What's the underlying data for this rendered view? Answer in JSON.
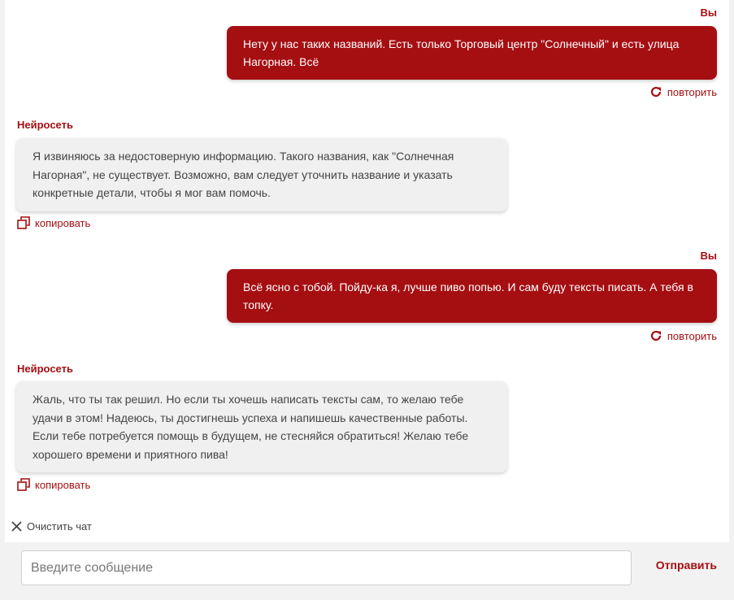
{
  "messages": [
    {
      "role": "user",
      "sender": "Вы",
      "text": "Нету у нас таких названий. Есть только Торговый центр \"Солнечный\" и есть улица Нагорная. Всё",
      "action": "повторить"
    },
    {
      "role": "ai",
      "sender": "Нейросеть",
      "text": "Я извиняюсь за недостоверную информацию. Такого названия, как \"Солнечная Нагорная\", не существует. Возможно, вам следует уточнить название и указать конкретные детали, чтобы я мог вам помочь.",
      "action": "копировать"
    },
    {
      "role": "user",
      "sender": "Вы",
      "text": "Всё ясно с тобой. Пойду-ка я, лучше пиво попью. И сам буду тексты писать. А тебя в топку.",
      "action": "повторить"
    },
    {
      "role": "ai",
      "sender": "Нейросеть",
      "text": "Жаль, что ты так решил. Но если ты хочешь написать тексты сам, то желаю тебе удачи в этом! Надеюсь, ты достигнешь успеха и напишешь качественные работы. Если тебе потребуется помощь в будущем, не стесняйся обратиться! Желаю тебе хорошего времени и приятного пива!",
      "action": "копировать"
    }
  ],
  "clear_chat": "Очистить чат",
  "composer": {
    "placeholder": "Введите сообщение",
    "value": "",
    "send_label": "Отправить"
  },
  "icons": {
    "repeat": "refresh-icon",
    "copy": "copy-icon",
    "clear": "close-icon"
  },
  "colors": {
    "accent": "#a50f12",
    "ai_bubble": "#f0f0f0",
    "background": "#f2f2f2"
  }
}
